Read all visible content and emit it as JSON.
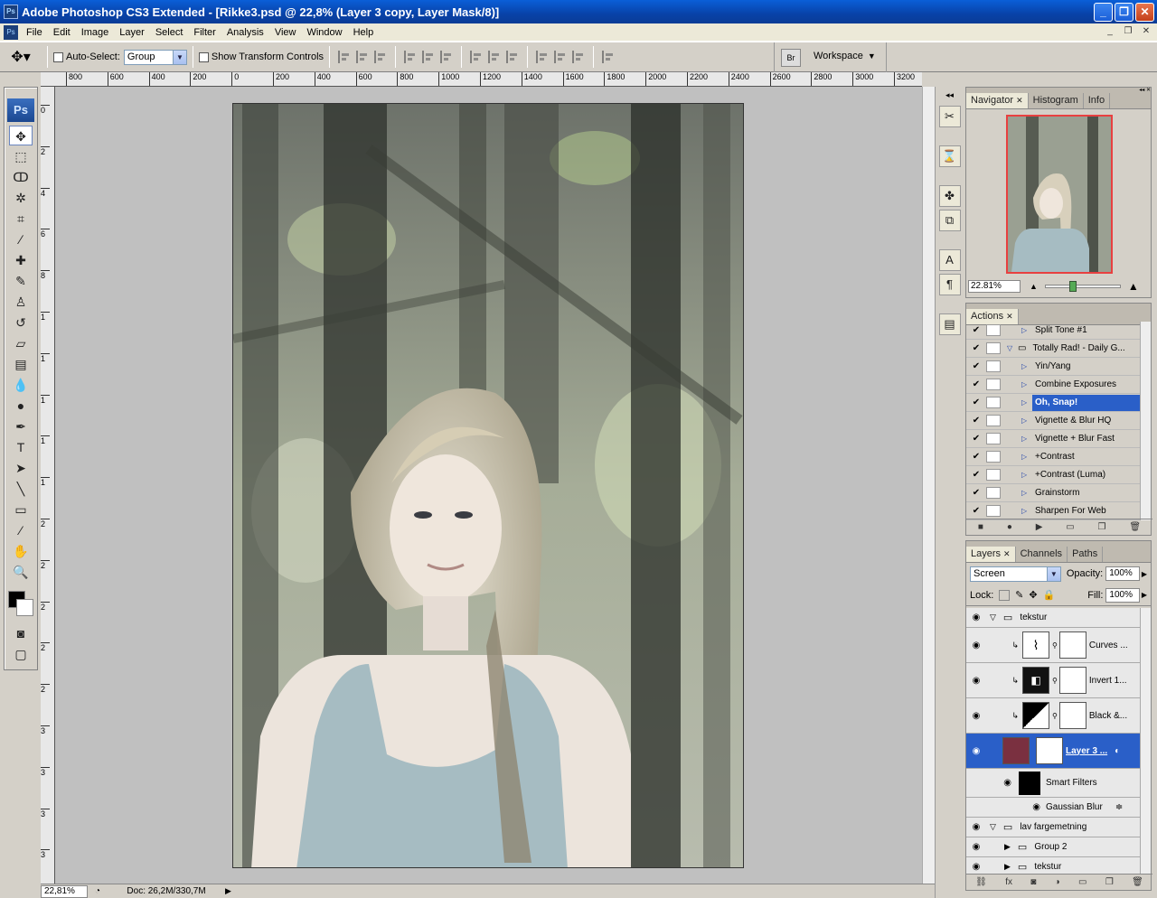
{
  "window": {
    "title": "Adobe Photoshop CS3 Extended - [Rikke3.psd @ 22,8% (Layer 3 copy, Layer Mask/8)]"
  },
  "menu": [
    "File",
    "Edit",
    "Image",
    "Layer",
    "Select",
    "Filter",
    "Analysis",
    "View",
    "Window",
    "Help"
  ],
  "options": {
    "auto_select_label": "Auto-Select:",
    "auto_select_value": "Group",
    "transform_label": "Show Transform Controls",
    "workspace_label": "Workspace"
  },
  "ruler_top": [
    "800",
    "600",
    "400",
    "200",
    "0",
    "200",
    "400",
    "600",
    "800",
    "1000",
    "1200",
    "1400",
    "1600",
    "1800",
    "2000",
    "2200",
    "2400",
    "2600",
    "2800",
    "3000",
    "3200"
  ],
  "ruler_left": [
    "0",
    "2",
    "4",
    "6",
    "8",
    "1",
    "1",
    "1",
    "1",
    "1",
    "2",
    "2",
    "2",
    "2",
    "2",
    "3",
    "3",
    "3",
    "3",
    "3"
  ],
  "status": {
    "zoom": "22,81%",
    "doc": "Doc: 26,2M/330,7M"
  },
  "navigator": {
    "tabs": [
      "Navigator",
      "Histogram",
      "Info"
    ],
    "zoom": "22.81%"
  },
  "actions": {
    "tabs": [
      "Actions"
    ],
    "items": [
      {
        "label": "Split Tone #1",
        "folder": false,
        "selected": false
      },
      {
        "label": "Totally Rad! - Daily G...",
        "folder": true,
        "selected": false
      },
      {
        "label": "Yin/Yang",
        "folder": false,
        "selected": false
      },
      {
        "label": "Combine Exposures",
        "folder": false,
        "selected": false
      },
      {
        "label": "Oh, Snap!",
        "folder": false,
        "selected": true
      },
      {
        "label": "Vignette & Blur HQ",
        "folder": false,
        "selected": false
      },
      {
        "label": "Vignette + Blur Fast",
        "folder": false,
        "selected": false
      },
      {
        "label": "+Contrast",
        "folder": false,
        "selected": false
      },
      {
        "label": "+Contrast (Luma)",
        "folder": false,
        "selected": false
      },
      {
        "label": "Grainstorm",
        "folder": false,
        "selected": false
      },
      {
        "label": "Sharpen For Web",
        "folder": false,
        "selected": false
      }
    ]
  },
  "layers": {
    "tabs": [
      "Layers",
      "Channels",
      "Paths"
    ],
    "blend_mode": "Screen",
    "opacity_label": "Opacity:",
    "opacity": "100%",
    "lock_label": "Lock:",
    "fill_label": "Fill:",
    "fill": "100%",
    "group_tekstur": "tekstur",
    "curves": "Curves ...",
    "invert": "Invert 1...",
    "bw": "Black &...",
    "layer3": "Layer 3 ...",
    "smart_filters": "Smart Filters",
    "gaussian": "Gaussian Blur",
    "group_lav": "lav fargemetning",
    "group2": "Group 2",
    "group_tekstur2": "tekstur"
  }
}
